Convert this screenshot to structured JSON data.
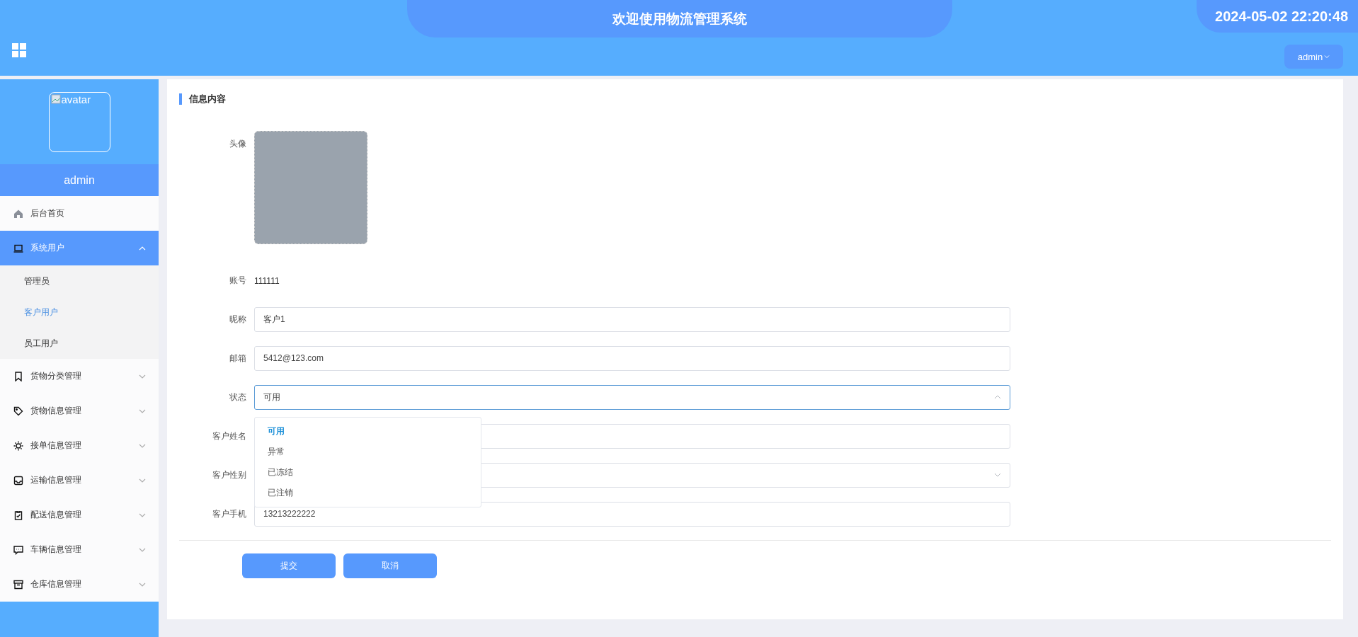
{
  "header": {
    "title": "欢迎使用物流管理系统",
    "datetime": "2024-05-02 22:20:48",
    "user_menu": "admin"
  },
  "sidebar": {
    "avatar_alt": "avatar",
    "username": "admin",
    "menu": [
      {
        "label": "后台首页",
        "selected": false
      },
      {
        "label": "系统用户",
        "selected": true,
        "expanded": true,
        "children": [
          {
            "label": "管理员",
            "selected": false
          },
          {
            "label": "客户用户",
            "selected": true
          },
          {
            "label": "员工用户",
            "selected": false
          }
        ]
      },
      {
        "label": "货物分类管理",
        "selected": false,
        "expanded": false
      },
      {
        "label": "货物信息管理",
        "selected": false,
        "expanded": false
      },
      {
        "label": "接单信息管理",
        "selected": false,
        "expanded": false
      },
      {
        "label": "运输信息管理",
        "selected": false,
        "expanded": false
      },
      {
        "label": "配送信息管理",
        "selected": false,
        "expanded": false
      },
      {
        "label": "车辆信息管理",
        "selected": false,
        "expanded": false
      },
      {
        "label": "仓库信息管理",
        "selected": false,
        "expanded": false
      }
    ]
  },
  "form": {
    "section_title": "信息内容",
    "fields": [
      {
        "label": "头像",
        "kind": "image"
      },
      {
        "label": "账号",
        "kind": "text",
        "value": "111111"
      },
      {
        "label": "昵称",
        "kind": "input",
        "value": "客户1"
      },
      {
        "label": "邮箱",
        "kind": "input",
        "value": "5412@123.com"
      },
      {
        "label": "状态",
        "kind": "select",
        "value": "可用",
        "open": true,
        "options": [
          {
            "label": "可用",
            "selected": true
          },
          {
            "label": "异常",
            "selected": false
          },
          {
            "label": "已冻结",
            "selected": false
          },
          {
            "label": "已注销",
            "selected": false
          }
        ]
      },
      {
        "label": "客户姓名",
        "kind": "input"
      },
      {
        "label": "客户性别",
        "kind": "select",
        "open": false
      },
      {
        "label": "客户手机",
        "kind": "input",
        "value": "13213222222"
      }
    ]
  },
  "buttons": [
    "提交",
    "取消"
  ]
}
